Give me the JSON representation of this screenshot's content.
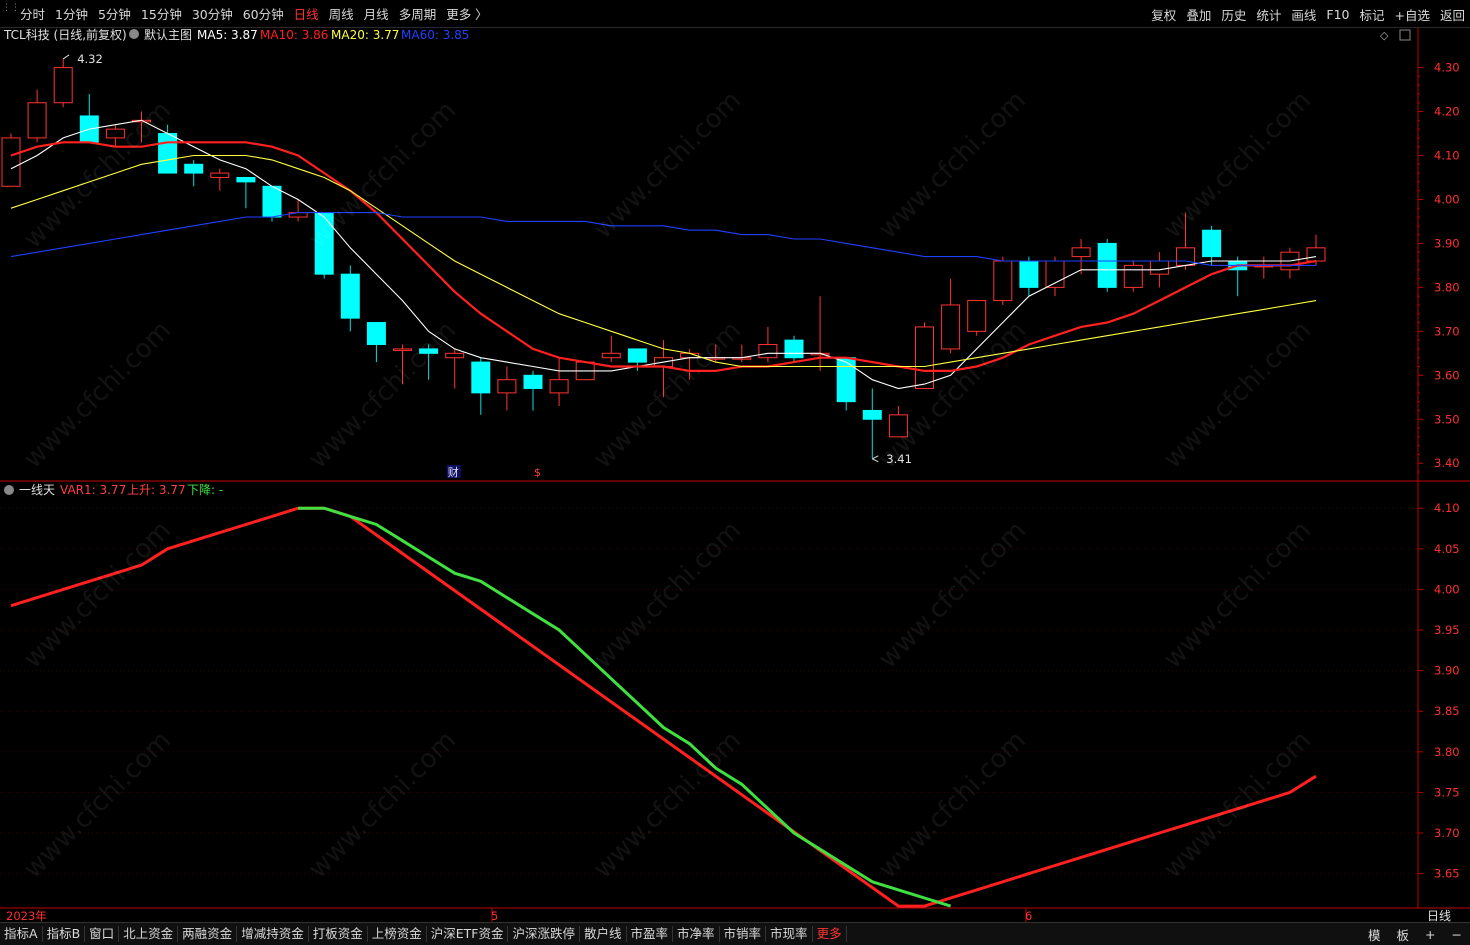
{
  "toolbar": {
    "periods": [
      "分时",
      "1分钟",
      "5分钟",
      "15分钟",
      "30分钟",
      "60分钟",
      "日线",
      "周线",
      "月线",
      "多周期",
      "更多 〉"
    ],
    "active_period": "日线",
    "right_tools": [
      "复权",
      "叠加",
      "历史",
      "统计",
      "画线",
      "F10",
      "标记",
      "+自选",
      "返回"
    ]
  },
  "bottom": {
    "tabs": [
      "指标A",
      "指标B",
      "窗口",
      "北上资金",
      "两融资金",
      "增减持资金",
      "打板资金",
      "上榜资金",
      "沪深ETF资金",
      "沪深涨跌停",
      "散户线",
      "市盈率",
      "市净率",
      "市销率",
      "市现率",
      "更多"
    ],
    "highlight_tab": "更多",
    "right_buttons": [
      "模",
      "板",
      "+",
      "−"
    ]
  },
  "main_panel": {
    "stock_title": "TCL科技 (日线,前复权)",
    "template_label": "默认主图",
    "ma_labels": [
      {
        "text": "MA5: 3.87",
        "color": "#ffffff"
      },
      {
        "text": "MA10: 3.86",
        "color": "#ff2020"
      },
      {
        "text": "MA20: 3.77",
        "color": "#ffff40"
      },
      {
        "text": "MA60: 3.85",
        "color": "#2040ff"
      }
    ],
    "y_ticks": [
      "4.30",
      "4.20",
      "4.10",
      "4.00",
      "3.90",
      "3.80",
      "3.70",
      "3.60",
      "3.50",
      "3.40"
    ],
    "high_label": "4.32",
    "low_label": "3.41",
    "event_markers": [
      "财",
      "$"
    ]
  },
  "sub_panel": {
    "indicator_name": "一线天",
    "var_labels": [
      {
        "text": "VAR1: 3.77",
        "color": "#ff4040"
      },
      {
        "text": "上升: 3.77",
        "color": "#ff4040"
      },
      {
        "text": "下降: -",
        "color": "#40e040"
      }
    ],
    "y_ticks": [
      "4.10",
      "4.05",
      "4.00",
      "3.95",
      "3.90",
      "3.85",
      "3.80",
      "3.75",
      "3.70",
      "3.65"
    ]
  },
  "x_axis": {
    "labels": [
      "2023年",
      "5",
      "6"
    ],
    "period_label": "日线"
  },
  "watermark": "www.cfchi.com",
  "chart_data": [
    {
      "type": "candlestick",
      "title": "TCL科技 (日线,前复权)",
      "ylim": [
        3.38,
        4.34
      ],
      "candles": [
        {
          "o": 4.03,
          "h": 4.15,
          "l": 4.05,
          "c": 4.14
        },
        {
          "o": 4.14,
          "h": 4.25,
          "l": 4.13,
          "c": 4.22
        },
        {
          "o": 4.22,
          "h": 4.32,
          "l": 4.21,
          "c": 4.3
        },
        {
          "o": 4.19,
          "h": 4.24,
          "l": 4.13,
          "c": 4.13
        },
        {
          "o": 4.14,
          "h": 4.17,
          "l": 4.12,
          "c": 4.16
        },
        {
          "o": 4.18,
          "h": 4.2,
          "l": 4.13,
          "c": 4.18
        },
        {
          "o": 4.15,
          "h": 4.17,
          "l": 4.06,
          "c": 4.06
        },
        {
          "o": 4.08,
          "h": 4.09,
          "l": 4.03,
          "c": 4.06
        },
        {
          "o": 4.05,
          "h": 4.07,
          "l": 4.02,
          "c": 4.06
        },
        {
          "o": 4.05,
          "h": 4.05,
          "l": 3.98,
          "c": 4.04
        },
        {
          "o": 4.03,
          "h": 4.03,
          "l": 3.95,
          "c": 3.96
        },
        {
          "o": 3.96,
          "h": 4.0,
          "l": 3.95,
          "c": 3.97
        },
        {
          "o": 3.97,
          "h": 3.97,
          "l": 3.82,
          "c": 3.83
        },
        {
          "o": 3.83,
          "h": 3.85,
          "l": 3.7,
          "c": 3.73
        },
        {
          "o": 3.72,
          "h": 3.72,
          "l": 3.63,
          "c": 3.67
        },
        {
          "o": 3.66,
          "h": 3.67,
          "l": 3.58,
          "c": 3.66
        },
        {
          "o": 3.66,
          "h": 3.67,
          "l": 3.59,
          "c": 3.65
        },
        {
          "o": 3.64,
          "h": 3.66,
          "l": 3.57,
          "c": 3.65
        },
        {
          "o": 3.63,
          "h": 3.64,
          "l": 3.51,
          "c": 3.56
        },
        {
          "o": 3.56,
          "h": 3.62,
          "l": 3.52,
          "c": 3.59
        },
        {
          "o": 3.6,
          "h": 3.61,
          "l": 3.52,
          "c": 3.57
        },
        {
          "o": 3.56,
          "h": 3.64,
          "l": 3.53,
          "c": 3.59
        },
        {
          "o": 3.59,
          "h": 3.63,
          "l": 3.59,
          "c": 3.63
        },
        {
          "o": 3.64,
          "h": 3.69,
          "l": 3.63,
          "c": 3.65
        },
        {
          "o": 3.66,
          "h": 3.66,
          "l": 3.61,
          "c": 3.63
        },
        {
          "o": 3.62,
          "h": 3.68,
          "l": 3.55,
          "c": 3.64
        },
        {
          "o": 3.64,
          "h": 3.66,
          "l": 3.59,
          "c": 3.65
        },
        {
          "o": 3.64,
          "h": 3.67,
          "l": 3.63,
          "c": 3.64
        },
        {
          "o": 3.64,
          "h": 3.67,
          "l": 3.63,
          "c": 3.64
        },
        {
          "o": 3.64,
          "h": 3.71,
          "l": 3.63,
          "c": 3.67
        },
        {
          "o": 3.68,
          "h": 3.69,
          "l": 3.63,
          "c": 3.64
        },
        {
          "o": 3.65,
          "h": 3.78,
          "l": 3.61,
          "c": 3.65
        },
        {
          "o": 3.64,
          "h": 3.64,
          "l": 3.52,
          "c": 3.54
        },
        {
          "o": 3.52,
          "h": 3.57,
          "l": 3.41,
          "c": 3.5
        },
        {
          "o": 3.46,
          "h": 3.53,
          "l": 3.46,
          "c": 3.51
        },
        {
          "o": 3.57,
          "h": 3.72,
          "l": 3.57,
          "c": 3.71
        },
        {
          "o": 3.66,
          "h": 3.82,
          "l": 3.65,
          "c": 3.76
        },
        {
          "o": 3.7,
          "h": 3.77,
          "l": 3.69,
          "c": 3.77
        },
        {
          "o": 3.77,
          "h": 3.87,
          "l": 3.76,
          "c": 3.86
        },
        {
          "o": 3.86,
          "h": 3.87,
          "l": 3.78,
          "c": 3.8
        },
        {
          "o": 3.8,
          "h": 3.87,
          "l": 3.78,
          "c": 3.86
        },
        {
          "o": 3.87,
          "h": 3.91,
          "l": 3.83,
          "c": 3.89
        },
        {
          "o": 3.9,
          "h": 3.91,
          "l": 3.79,
          "c": 3.8
        },
        {
          "o": 3.8,
          "h": 3.86,
          "l": 3.79,
          "c": 3.85
        },
        {
          "o": 3.83,
          "h": 3.88,
          "l": 3.8,
          "c": 3.86
        },
        {
          "o": 3.85,
          "h": 3.97,
          "l": 3.84,
          "c": 3.89
        },
        {
          "o": 3.93,
          "h": 3.94,
          "l": 3.85,
          "c": 3.87
        },
        {
          "o": 3.86,
          "h": 3.87,
          "l": 3.78,
          "c": 3.84
        },
        {
          "o": 3.85,
          "h": 3.87,
          "l": 3.82,
          "c": 3.85
        },
        {
          "o": 3.84,
          "h": 3.89,
          "l": 3.82,
          "c": 3.88
        },
        {
          "o": 3.86,
          "h": 3.92,
          "l": 3.85,
          "c": 3.89
        }
      ],
      "series": [
        {
          "name": "MA5",
          "color": "#ffffff",
          "values": [
            4.07,
            4.1,
            4.14,
            4.16,
            4.17,
            4.18,
            4.15,
            4.12,
            4.09,
            4.07,
            4.03,
            4.0,
            3.96,
            3.89,
            3.83,
            3.77,
            3.7,
            3.66,
            3.64,
            3.63,
            3.62,
            3.61,
            3.61,
            3.61,
            3.62,
            3.63,
            3.64,
            3.64,
            3.64,
            3.65,
            3.65,
            3.65,
            3.63,
            3.59,
            3.57,
            3.58,
            3.6,
            3.66,
            3.72,
            3.78,
            3.81,
            3.84,
            3.84,
            3.84,
            3.84,
            3.85,
            3.86,
            3.86,
            3.86,
            3.86,
            3.87
          ]
        },
        {
          "name": "MA10",
          "color": "#ff2020",
          "values": [
            4.1,
            4.12,
            4.13,
            4.13,
            4.12,
            4.12,
            4.13,
            4.13,
            4.13,
            4.13,
            4.12,
            4.1,
            4.06,
            4.02,
            3.97,
            3.91,
            3.85,
            3.79,
            3.74,
            3.7,
            3.66,
            3.64,
            3.63,
            3.62,
            3.62,
            3.62,
            3.61,
            3.61,
            3.62,
            3.62,
            3.63,
            3.64,
            3.64,
            3.63,
            3.62,
            3.61,
            3.61,
            3.62,
            3.64,
            3.67,
            3.69,
            3.71,
            3.72,
            3.74,
            3.77,
            3.8,
            3.83,
            3.85,
            3.85,
            3.85,
            3.86
          ]
        },
        {
          "name": "MA20",
          "color": "#ffff40",
          "values": [
            3.98,
            4.0,
            4.02,
            4.04,
            4.06,
            4.08,
            4.09,
            4.1,
            4.1,
            4.1,
            4.09,
            4.07,
            4.05,
            4.02,
            3.98,
            3.94,
            3.9,
            3.86,
            3.83,
            3.8,
            3.77,
            3.74,
            3.72,
            3.7,
            3.68,
            3.66,
            3.65,
            3.63,
            3.62,
            3.62,
            3.62,
            3.62,
            3.62,
            3.62,
            3.62,
            3.62,
            3.63,
            3.64,
            3.65,
            3.66,
            3.67,
            3.68,
            3.69,
            3.7,
            3.71,
            3.72,
            3.73,
            3.74,
            3.75,
            3.76,
            3.77
          ]
        },
        {
          "name": "MA60",
          "color": "#2040ff",
          "values": [
            3.87,
            3.88,
            3.89,
            3.9,
            3.91,
            3.92,
            3.93,
            3.94,
            3.95,
            3.96,
            3.96,
            3.97,
            3.97,
            3.97,
            3.97,
            3.96,
            3.96,
            3.96,
            3.96,
            3.95,
            3.95,
            3.95,
            3.95,
            3.94,
            3.94,
            3.94,
            3.93,
            3.93,
            3.92,
            3.92,
            3.91,
            3.91,
            3.9,
            3.89,
            3.88,
            3.87,
            3.87,
            3.87,
            3.86,
            3.86,
            3.86,
            3.86,
            3.86,
            3.86,
            3.86,
            3.86,
            3.85,
            3.85,
            3.85,
            3.85,
            3.85
          ]
        }
      ]
    },
    {
      "type": "line",
      "title": "一线天",
      "ylim": [
        3.62,
        4.12
      ],
      "series": [
        {
          "name": "上升",
          "color": "#ff2020",
          "values": [
            3.98,
            3.99,
            4.0,
            4.01,
            4.02,
            4.03,
            4.05,
            4.06,
            4.07,
            4.08,
            4.09,
            4.1,
            4.1,
            4.09,
            null,
            null,
            null,
            null,
            null,
            null,
            null,
            null,
            null,
            null,
            null,
            null,
            null,
            null,
            null,
            null,
            null,
            null,
            null,
            null,
            3.61,
            3.61,
            3.62,
            3.63,
            3.64,
            3.65,
            3.66,
            3.67,
            3.68,
            3.69,
            3.7,
            3.71,
            3.72,
            3.73,
            3.74,
            3.75,
            3.77
          ]
        },
        {
          "name": "下降",
          "color": "#40e040",
          "values": [
            null,
            null,
            null,
            null,
            null,
            null,
            null,
            null,
            null,
            null,
            null,
            4.1,
            4.1,
            4.09,
            4.08,
            4.06,
            4.04,
            4.02,
            4.01,
            3.99,
            3.97,
            3.95,
            3.92,
            3.89,
            3.86,
            3.83,
            3.81,
            3.78,
            3.76,
            3.73,
            3.7,
            3.68,
            3.66,
            3.64,
            3.63,
            3.62,
            3.61
          ]
        }
      ]
    }
  ]
}
